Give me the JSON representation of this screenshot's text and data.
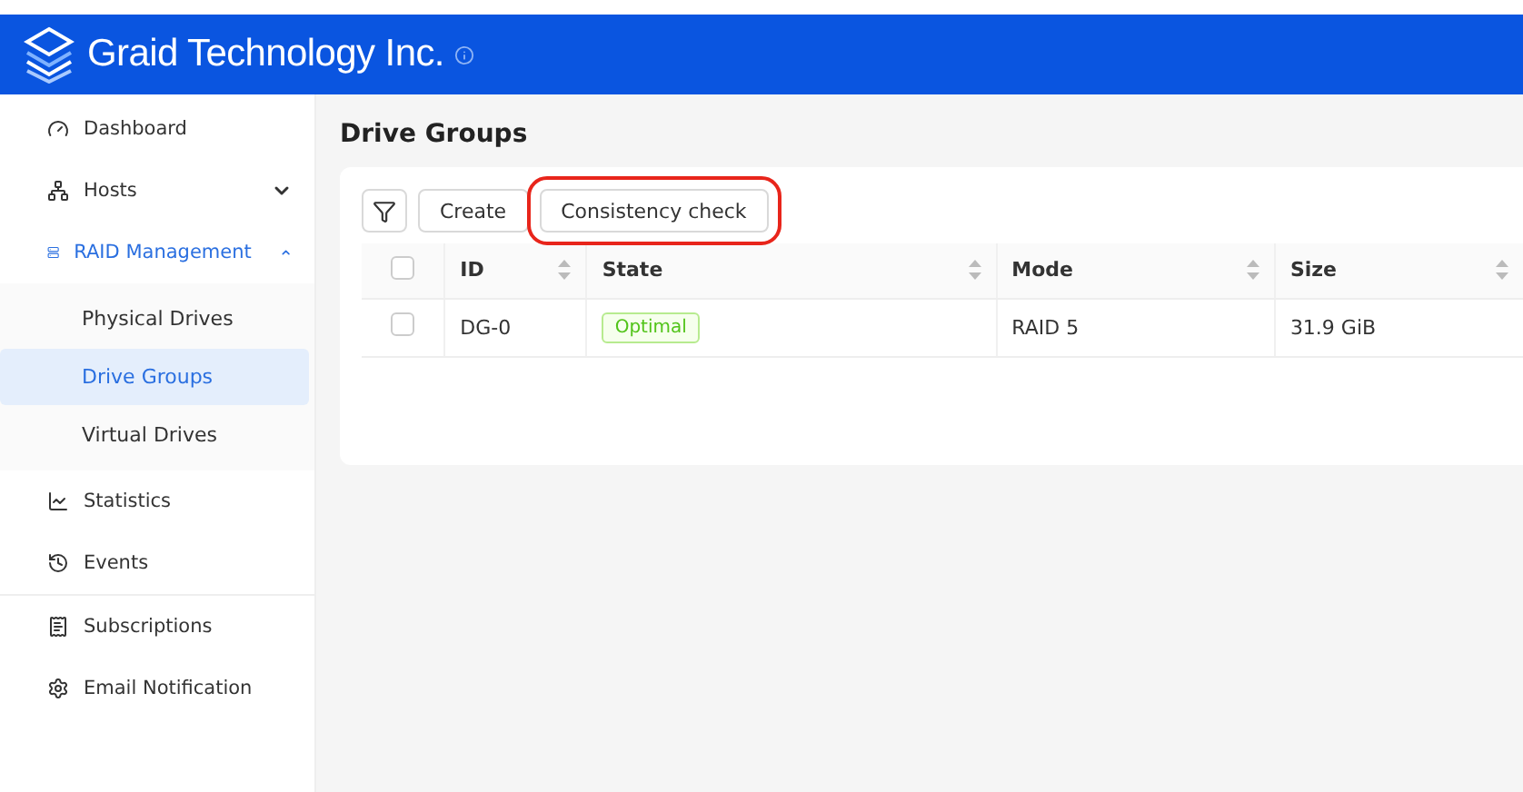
{
  "header": {
    "title": "Graid Technology Inc."
  },
  "sidebar": {
    "groups": [
      {
        "items": [
          {
            "label": "Dashboard",
            "selected": false
          },
          {
            "label": "Hosts",
            "selected": false,
            "expanded": false
          },
          {
            "label": "RAID Management",
            "selected": true,
            "expanded": true,
            "children": [
              {
                "label": "Physical Drives",
                "selected": false
              },
              {
                "label": "Drive Groups",
                "selected": true
              },
              {
                "label": "Virtual Drives",
                "selected": false
              }
            ]
          },
          {
            "label": "Statistics",
            "selected": false
          },
          {
            "label": "Events",
            "selected": false
          }
        ]
      },
      {
        "items": [
          {
            "label": "Subscriptions",
            "selected": false
          },
          {
            "label": "Email Notification",
            "selected": false
          }
        ]
      }
    ]
  },
  "page": {
    "title": "Drive Groups"
  },
  "toolbar": {
    "buttons": [
      {
        "label": "Create",
        "highlighted": false
      },
      {
        "label": "Consistency check",
        "highlighted": true
      }
    ]
  },
  "table": {
    "columns": [
      {
        "label": "ID",
        "sortable": true
      },
      {
        "label": "State",
        "sortable": true
      },
      {
        "label": "Mode",
        "sortable": true
      },
      {
        "label": "Size",
        "sortable": true
      }
    ],
    "header_checked": false,
    "rows": [
      {
        "checked": false,
        "id": "DG-0",
        "state": "Optimal",
        "mode": "RAID 5",
        "size": "31.9 GiB"
      }
    ]
  }
}
